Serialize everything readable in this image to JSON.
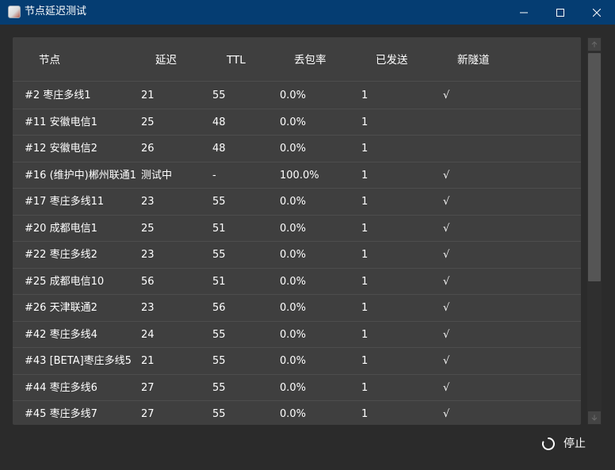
{
  "window": {
    "title": "节点延迟测试"
  },
  "table": {
    "columns": [
      "节点",
      "延迟",
      "TTL",
      "丢包率",
      "已发送",
      "新隧道"
    ],
    "rows": [
      {
        "node": "#2 枣庄多线1",
        "latency": "21",
        "ttl": "55",
        "loss": "0.0%",
        "sent": "1",
        "tunnel": "√"
      },
      {
        "node": "#11 安徽电信1",
        "latency": "25",
        "ttl": "48",
        "loss": "0.0%",
        "sent": "1",
        "tunnel": ""
      },
      {
        "node": "#12 安徽电信2",
        "latency": "26",
        "ttl": "48",
        "loss": "0.0%",
        "sent": "1",
        "tunnel": ""
      },
      {
        "node": "#16 (维护中)郴州联通1",
        "latency": "测试中",
        "ttl": "-",
        "loss": "100.0%",
        "sent": "1",
        "tunnel": "√"
      },
      {
        "node": "#17 枣庄多线11",
        "latency": "23",
        "ttl": "55",
        "loss": "0.0%",
        "sent": "1",
        "tunnel": "√"
      },
      {
        "node": "#20 成都电信1",
        "latency": "25",
        "ttl": "51",
        "loss": "0.0%",
        "sent": "1",
        "tunnel": "√"
      },
      {
        "node": "#22 枣庄多线2",
        "latency": "23",
        "ttl": "55",
        "loss": "0.0%",
        "sent": "1",
        "tunnel": "√"
      },
      {
        "node": "#25 成都电信10",
        "latency": "56",
        "ttl": "51",
        "loss": "0.0%",
        "sent": "1",
        "tunnel": "√"
      },
      {
        "node": "#26 天津联通2",
        "latency": "23",
        "ttl": "56",
        "loss": "0.0%",
        "sent": "1",
        "tunnel": "√"
      },
      {
        "node": "#42 枣庄多线4",
        "latency": "24",
        "ttl": "55",
        "loss": "0.0%",
        "sent": "1",
        "tunnel": "√"
      },
      {
        "node": "#43 [BETA]枣庄多线5",
        "latency": "21",
        "ttl": "55",
        "loss": "0.0%",
        "sent": "1",
        "tunnel": "√"
      },
      {
        "node": "#44 枣庄多线6",
        "latency": "27",
        "ttl": "55",
        "loss": "0.0%",
        "sent": "1",
        "tunnel": "√"
      },
      {
        "node": "#45 枣庄多线7",
        "latency": "27",
        "ttl": "55",
        "loss": "0.0%",
        "sent": "1",
        "tunnel": "√"
      }
    ]
  },
  "footer": {
    "stop_label": "停止"
  },
  "icons": {
    "app": "app-icon",
    "minimize": "minimize-icon",
    "maximize": "maximize-icon",
    "close": "close-icon",
    "stop": "loading-spinner-icon",
    "scroll_up": "scroll-up-arrow-icon",
    "scroll_down": "scroll-down-arrow-icon"
  },
  "colors": {
    "titlebar": "#053d72",
    "background": "#2b2b2b",
    "panel": "#3f3f3f",
    "divider": "#4d4d4d",
    "text": "#ffffff"
  }
}
